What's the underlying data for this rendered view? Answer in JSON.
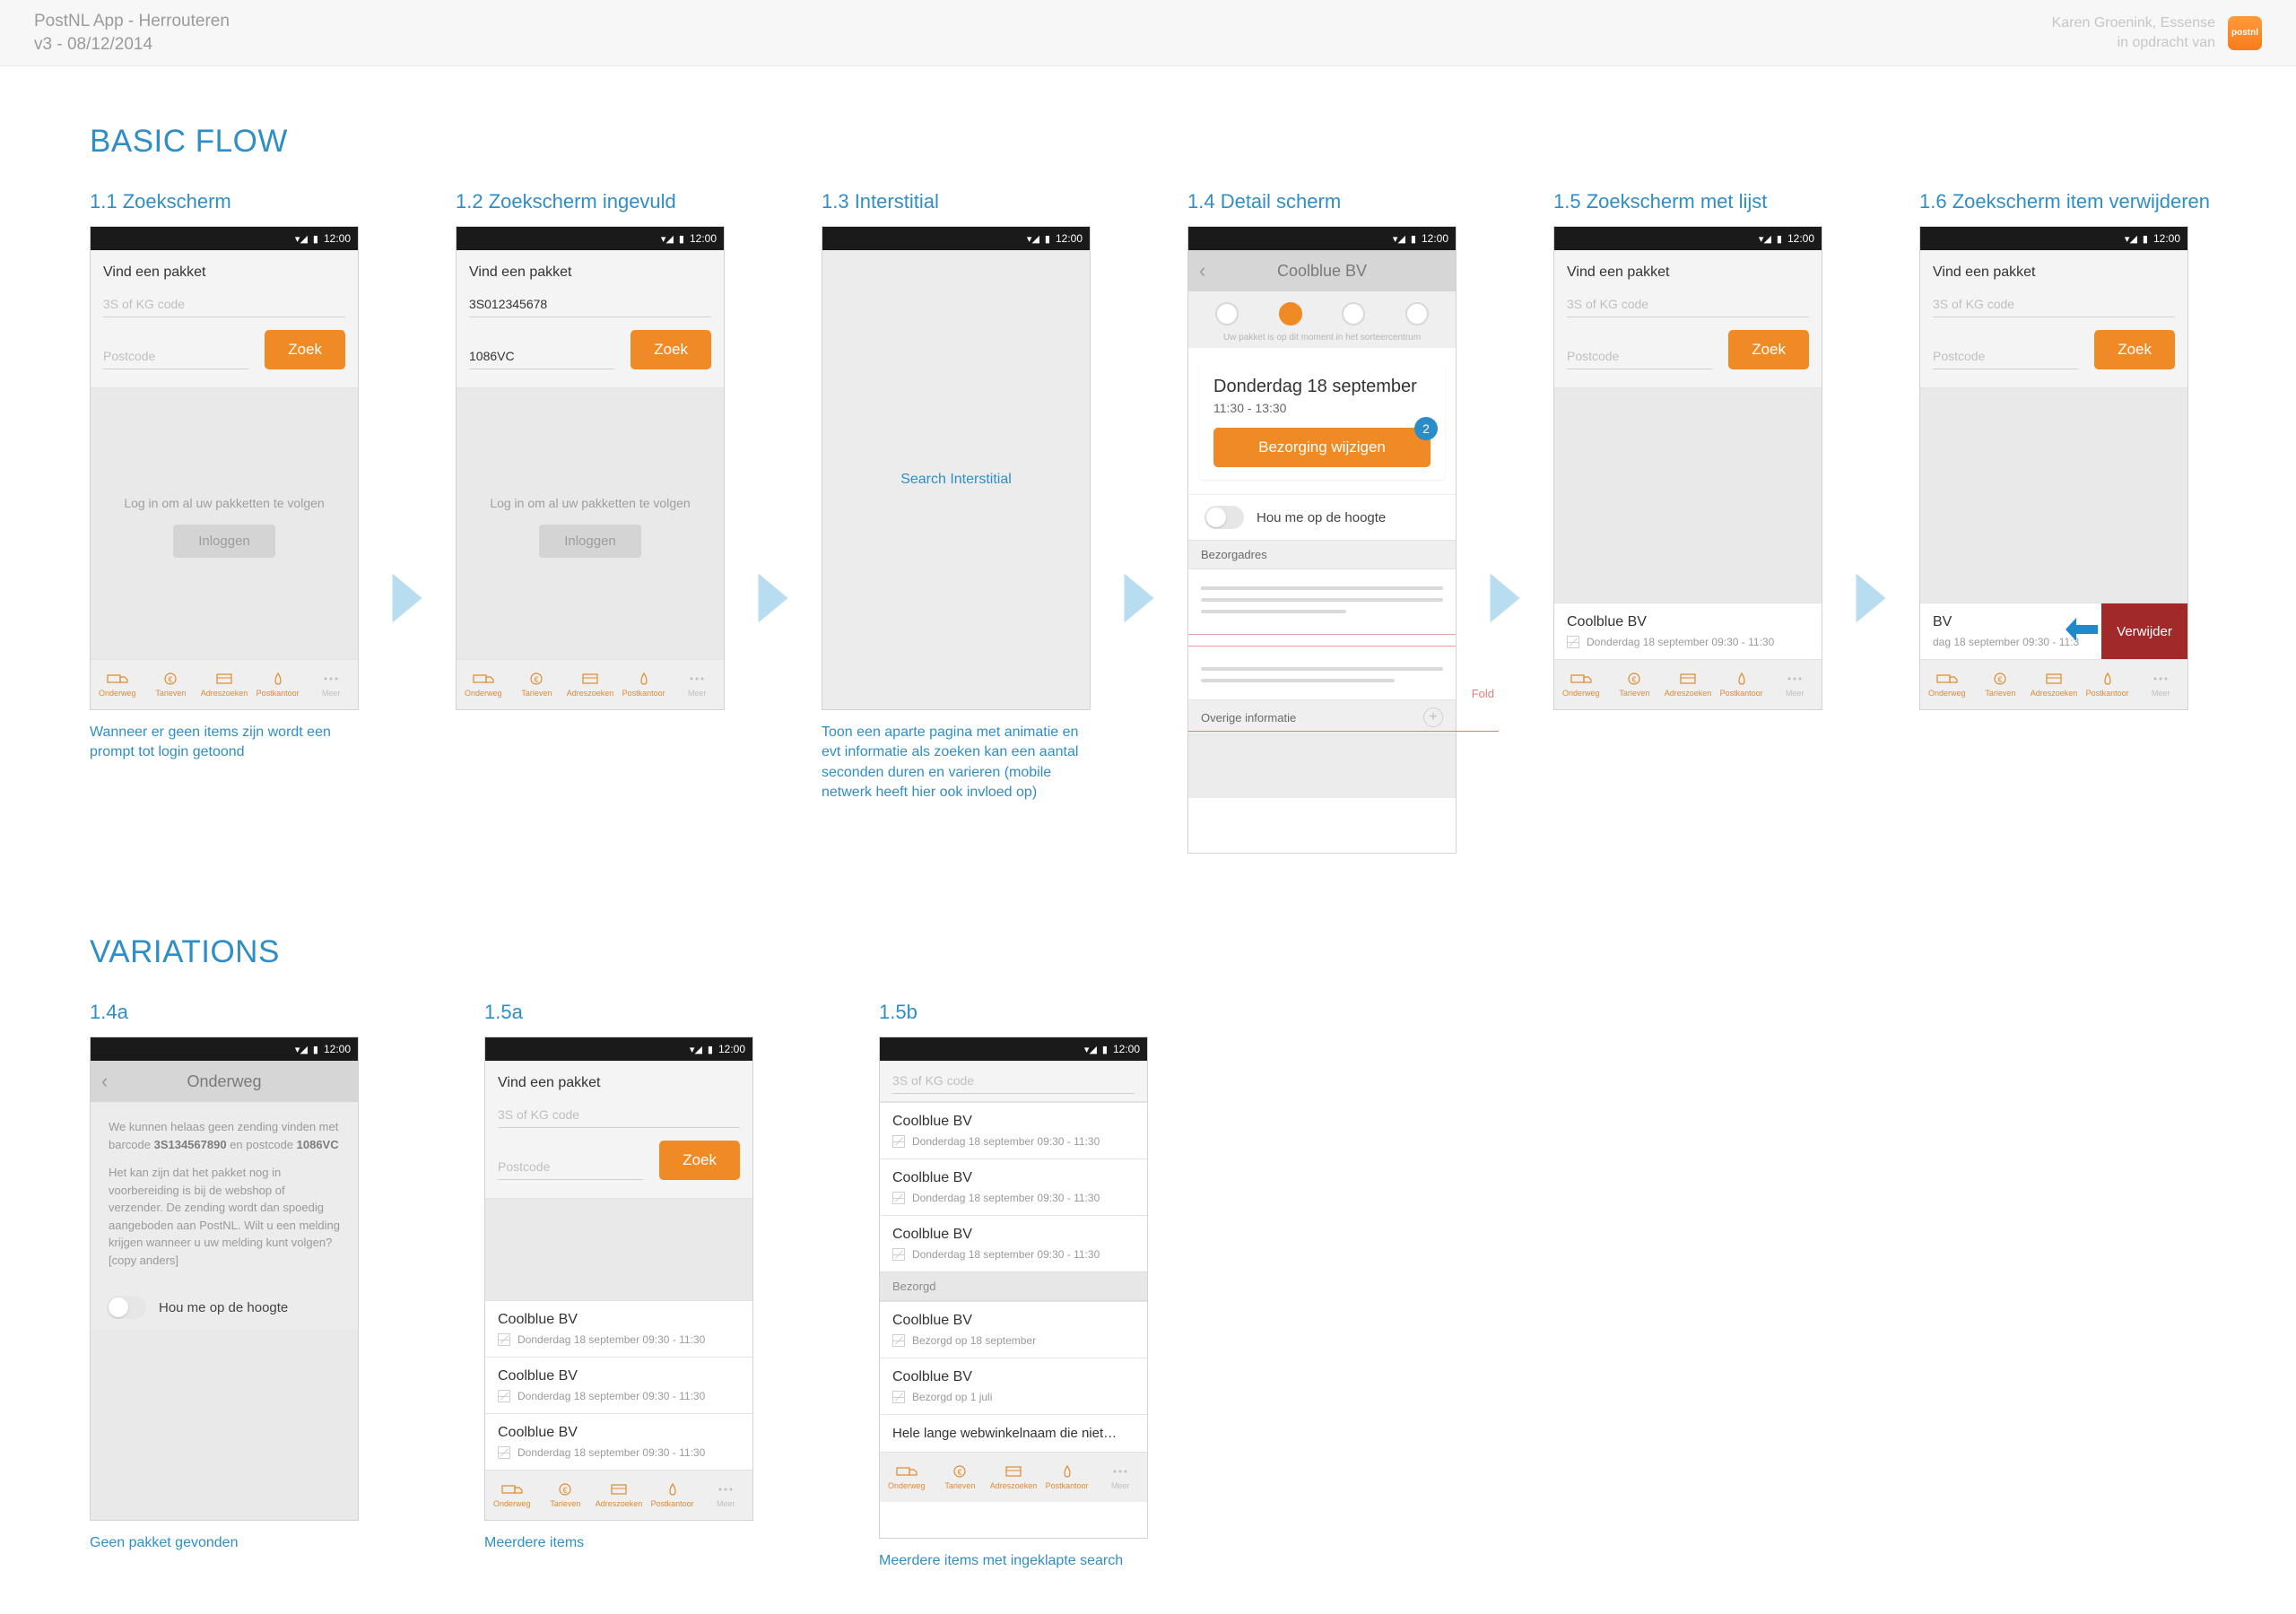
{
  "meta": {
    "title": "PostNL App - Herrouteren",
    "version": "v3 - 08/12/2014",
    "credit1": "Karen Groenink, Essense",
    "credit2": "in opdracht van",
    "brand": "postnl"
  },
  "sections": {
    "basic": "BASIC FLOW",
    "variations": "VARIATIONS"
  },
  "status": {
    "time": "12:00"
  },
  "search": {
    "heading": "Vind een pakket",
    "placeholder_code": "3S of KG code",
    "placeholder_postcode": "Postcode",
    "btn": "Zoek",
    "filled_code": "3S012345678",
    "filled_postcode": "1086VC",
    "login_hint": "Log in om al uw pakketten te volgen",
    "login_btn": "Inloggen"
  },
  "tabs": {
    "t1": "Onderweg",
    "t2": "Tarieven",
    "t3": "Adreszoeken",
    "t4": "Postkantoor",
    "t5": "Meer"
  },
  "frames": {
    "f11": {
      "title": "1.1 Zoekscherm",
      "caption": "Wanneer er geen items zijn wordt een prompt tot login getoond"
    },
    "f12": {
      "title": "1.2 Zoekscherm ingevuld"
    },
    "f13": {
      "title": "1.3 Interstitial",
      "label": "Search Interstitial",
      "caption": "Toon een aparte pagina met animatie en evt informatie als zoeken kan een aantal seconden duren en varieren (mobile netwerk heeft hier ook invloed op)"
    },
    "f14": {
      "title": "1.4 Detail scherm",
      "nav": "Coolblue BV",
      "stepnote": "Uw pakket is op dit moment in het sorteercentrum",
      "date": "Donderdag 18 september",
      "time": "11:30 - 13:30",
      "btn": "Bezorging wijzigen",
      "badge": "2",
      "toggle": "Hou me op de hoogte",
      "addr_hdr": "Bezorgadres",
      "other_hdr": "Overige informatie",
      "fold": "Fold"
    },
    "f15": {
      "title": "1.5 Zoekscherm met lijst",
      "item_title": "Coolblue BV",
      "item_sub": "Donderdag 18 september 09:30 - 11:30"
    },
    "f16": {
      "title": "1.6 Zoekscherm item verwijderen",
      "item_title_trunc": "BV",
      "item_sub_trunc": "dag 18 september 09:30 - 11:3",
      "delete": "Verwijder"
    },
    "f14a": {
      "title": "1.4a",
      "nav": "Onderweg",
      "line1a": "We kunnen helaas geen zending vinden met barcode ",
      "code": "3S134567890",
      "line1b": " en postcode ",
      "pc": "1086VC",
      "line2": "Het kan zijn dat het pakket nog in voorbereiding is bij de webshop of verzender. De zending wordt dan spoedig aangeboden aan PostNL. Wilt u een melding krijgen wanneer u uw melding kunt volgen? [copy anders]",
      "toggle": "Hou me op de hoogte",
      "caption": "Geen pakket gevonden"
    },
    "f15a": {
      "title": "1.5a",
      "caption": "Meerdere items"
    },
    "f15b": {
      "title": "1.5b",
      "delivered_hdr": "Bezorgd",
      "del1": "Bezorgd op 18 september",
      "del2": "Bezorgd op 1 juli",
      "long": "Hele lange webwinkelnaam die niet…",
      "caption": "Meerdere items met ingeklapte search"
    }
  }
}
